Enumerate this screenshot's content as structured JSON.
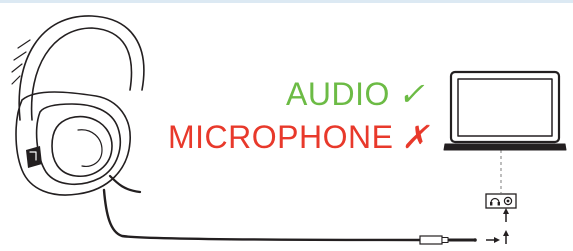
{
  "labels": {
    "audio": {
      "text": "AUDIO",
      "mark": "✓",
      "color": "#6cbb45"
    },
    "microphone": {
      "text": "MICROPHONE",
      "mark": "✗",
      "color": "#e8392b"
    }
  },
  "icons": {
    "headset": "headset-icon",
    "laptop": "laptop-icon",
    "jack_port": "headphone-jack-icon",
    "plug": "audio-plug-icon",
    "insert_arrows": "arrow-icon"
  },
  "colors": {
    "line": "#231f20",
    "dashed_connector": "#9a9a9a",
    "top_band": "#dce9f3"
  }
}
